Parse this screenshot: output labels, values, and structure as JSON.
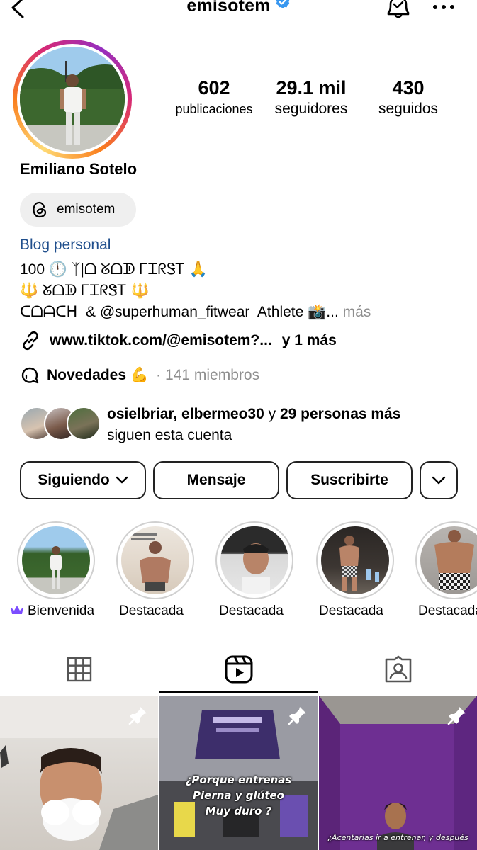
{
  "header": {
    "username": "emisotem",
    "verified": true
  },
  "stats": [
    {
      "value": "602",
      "label": "publicaciones"
    },
    {
      "value": "29.1 mil",
      "label": "seguidores"
    },
    {
      "value": "430",
      "label": "seguidos"
    }
  ],
  "profile": {
    "full_name": "Emiliano Sotelo",
    "threads_handle": "emisotem",
    "category": "Blog personal",
    "bio_line1": "100 🕛 ᛉ|ᗝ ᘜᗝᗫ ᎱᏆᖇᏕᎢ 🙏",
    "bio_line2": "🔱 ᘜᗝᗫ ᎱᏆᖇᏕᎢ 🔱",
    "bio_line3": "ᑕᗝᗩᑕᕼ  & @superhuman_fitwear  Athlete 📸...",
    "bio_more": "más",
    "link_text": "www.tiktok.com/@emisotem?...",
    "link_extra": "y 1 más"
  },
  "channel": {
    "name": "Novedades 💪",
    "separator": "·",
    "members": "141 miembros"
  },
  "followed_by": {
    "names": "osielbriar, elbermeo30",
    "connector": "y",
    "others": "29 personas más",
    "line2": "siguen esta cuenta"
  },
  "actions": {
    "following_label": "Siguiendo",
    "message_label": "Mensaje",
    "subscribe_label": "Suscribirte"
  },
  "highlights": [
    {
      "label": "Bienvenida",
      "icon": "crown-icon"
    },
    {
      "label": "Destacada"
    },
    {
      "label": "Destacada"
    },
    {
      "label": "Destacada"
    },
    {
      "label": "Destacada"
    }
  ],
  "tabs": [
    "grid-icon",
    "reels-icon",
    "tagged-icon"
  ],
  "active_tab": "reels",
  "reels": [
    {
      "caption": ""
    },
    {
      "caption_l1": "¿Porque entrenas",
      "caption_l2": "Pierna y glúteo",
      "caption_l3": "Muy duro ?"
    },
    {
      "caption": "¿Acentarias ir a entrenar, y después"
    }
  ],
  "colors": {
    "accent_blue": "#1f4e8c",
    "verified_blue": "#3897f0",
    "gray_text": "#8e8e8e",
    "crown_purple": "#7c4dff"
  }
}
